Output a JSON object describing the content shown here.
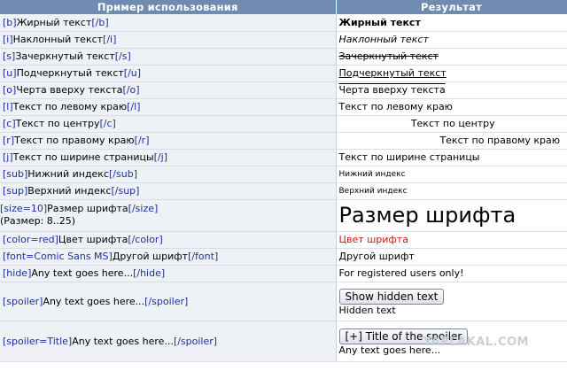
{
  "headers": {
    "left": "Пример использования",
    "right": "Результат"
  },
  "rows": {
    "bold": {
      "open": "[b]",
      "text": "Жирный текст",
      "close": "[/b]",
      "result": "Жирный текст"
    },
    "italic": {
      "open": "[i]",
      "text": "Наклонный текст",
      "close": "[/i]",
      "result": "Наклонный текст"
    },
    "strike": {
      "open": "[s]",
      "text": "Зачеркнутый текст",
      "close": "[/s]",
      "result": "Зачеркнутый текст"
    },
    "underline": {
      "open": "[u]",
      "text": "Подчеркнутый текст",
      "close": "[/u]",
      "result": "Подчеркнутый текст"
    },
    "overline": {
      "open": "[o]",
      "text": "Черта вверху текста",
      "close": "[/o]",
      "result": "Черта вверху текста"
    },
    "left": {
      "open": "[l]",
      "text": "Текст по левому краю",
      "close": "[/l]",
      "result": "Текст по левому краю"
    },
    "center": {
      "open": "[c]",
      "text": "Текст по центру",
      "close": "[/c]",
      "result": "Текст по центру"
    },
    "right": {
      "open": "[r]",
      "text": "Текст по правому краю",
      "close": "[/r]",
      "result": "Текст по правому краю"
    },
    "justify": {
      "open": "[j]",
      "text": "Текст по ширине страницы",
      "close": "[/j]",
      "result": "Текст по ширине страницы"
    },
    "sub": {
      "open": "[sub]",
      "text": "Нижний индекс",
      "close": "[/sub]",
      "result": "Нижний индекс"
    },
    "sup": {
      "open": "[sup]",
      "text": "Верхний индекс",
      "close": "[/sup]",
      "result": "Верхний индекс"
    },
    "size": {
      "open": "[size=10]",
      "text": "Размер шрифта",
      "close": "[/size]",
      "note": "(Размер: 8..25)",
      "result": "Размер шрифта"
    },
    "color": {
      "open": "[color=red]",
      "text": "Цвет шрифта",
      "close": "[/color]",
      "result": "Цвет шрифта",
      "result_color": "#d01818"
    },
    "font": {
      "open": "[font=Comic Sans MS]",
      "text": "Другой шрифт",
      "close": "[/font]",
      "result": "Другой шрифт"
    },
    "hide": {
      "open": "[hide]",
      "text": "Any text goes here...",
      "close": "[/hide]",
      "result": "For registered users only!"
    },
    "spoiler": {
      "open": "[spoiler]",
      "text": "Any text goes here...",
      "close": "[/spoiler]",
      "button": "Show hidden text",
      "result": "Hidden text"
    },
    "spoiler_title": {
      "open": "[spoiler=Title]",
      "text": "Any text goes here...",
      "close": "[/spoiler]",
      "button": "[+] Title of the spoiler",
      "result": "Any text goes here..."
    }
  },
  "watermark": "YAPLAKAL.COM",
  "colors": {
    "header_bg": "#6f8bb0",
    "tag": "#1d2f9c",
    "left_bg": "#eef1f6"
  }
}
